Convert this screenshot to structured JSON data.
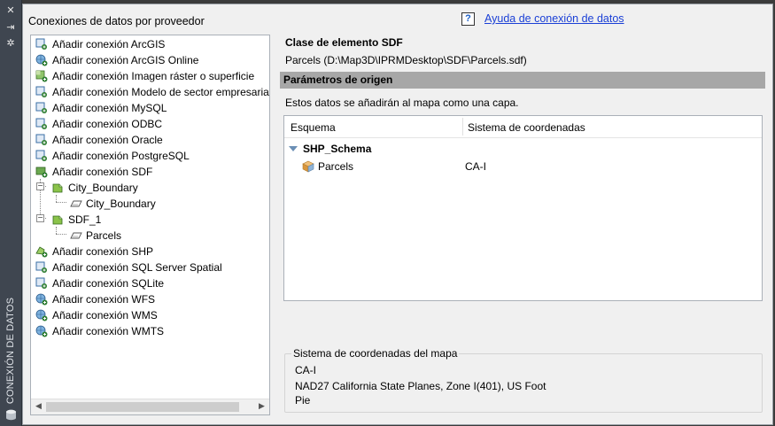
{
  "palette": {
    "sidebar_bg": "#3f4650",
    "panel_bg": "#f0f0f0",
    "section_bar": "#a7a7a7",
    "link": "#1a3fd6"
  },
  "sidebar": {
    "icons": [
      "close-icon",
      "pin-icon",
      "settings-icon",
      "database-icon"
    ],
    "title": "CONEXIÓN DE DATOS"
  },
  "left_panel": {
    "title": "Conexiones de datos por proveedor",
    "tree": [
      {
        "label": "Añadir conexión ArcGIS",
        "icon": "connection-icon"
      },
      {
        "label": "Añadir conexión ArcGIS Online",
        "icon": "globe-connection-icon"
      },
      {
        "label": "Añadir conexión Imagen ráster o superficie",
        "icon": "raster-connection-icon"
      },
      {
        "label": "Añadir conexión Modelo de sector empresarial",
        "icon": "connection-icon"
      },
      {
        "label": "Añadir conexión MySQL",
        "icon": "connection-icon"
      },
      {
        "label": "Añadir conexión ODBC",
        "icon": "connection-icon"
      },
      {
        "label": "Añadir conexión Oracle",
        "icon": "connection-icon"
      },
      {
        "label": "Añadir conexión PostgreSQL",
        "icon": "connection-icon"
      },
      {
        "label": "Añadir conexión SDF",
        "icon": "sdf-connection-icon"
      },
      {
        "label": "City_Boundary",
        "icon": "sdf-file-icon"
      },
      {
        "label": "City_Boundary",
        "icon": "polygon-layer-icon"
      },
      {
        "label": "SDF_1",
        "icon": "sdf-file-icon"
      },
      {
        "label": "Parcels",
        "icon": "polygon-layer-icon"
      },
      {
        "label": "Añadir conexión SHP",
        "icon": "shp-connection-icon"
      },
      {
        "label": "Añadir conexión SQL Server Spatial",
        "icon": "connection-icon"
      },
      {
        "label": "Añadir conexión SQLite",
        "icon": "connection-icon"
      },
      {
        "label": "Añadir conexión WFS",
        "icon": "globe-connection-icon"
      },
      {
        "label": "Añadir conexión WMS",
        "icon": "globe-connection-icon"
      },
      {
        "label": "Añadir conexión WMTS",
        "icon": "globe-connection-icon"
      }
    ]
  },
  "help": {
    "icon_text": "?",
    "link": "Ayuda de conexión de datos"
  },
  "feature_class": {
    "title": "Clase de elemento SDF",
    "path": "Parcels (D:\\Map3D\\IPRMDesktop\\SDF\\Parcels.sdf)"
  },
  "source_params": {
    "title": "Parámetros de origen",
    "description": "Estos datos se añadirán al mapa como una capa.",
    "columns": [
      "Esquema",
      "Sistema de coordenadas"
    ],
    "schema": "SHP_Schema",
    "rows": [
      {
        "name": "Parcels",
        "coord_system": "CA-I"
      }
    ]
  },
  "map_coords": {
    "legend": "Sistema de coordenadas del mapa",
    "code": "CA-I",
    "description": "NAD27 California State Planes, Zone I(401), US Foot",
    "unit": "Pie"
  }
}
